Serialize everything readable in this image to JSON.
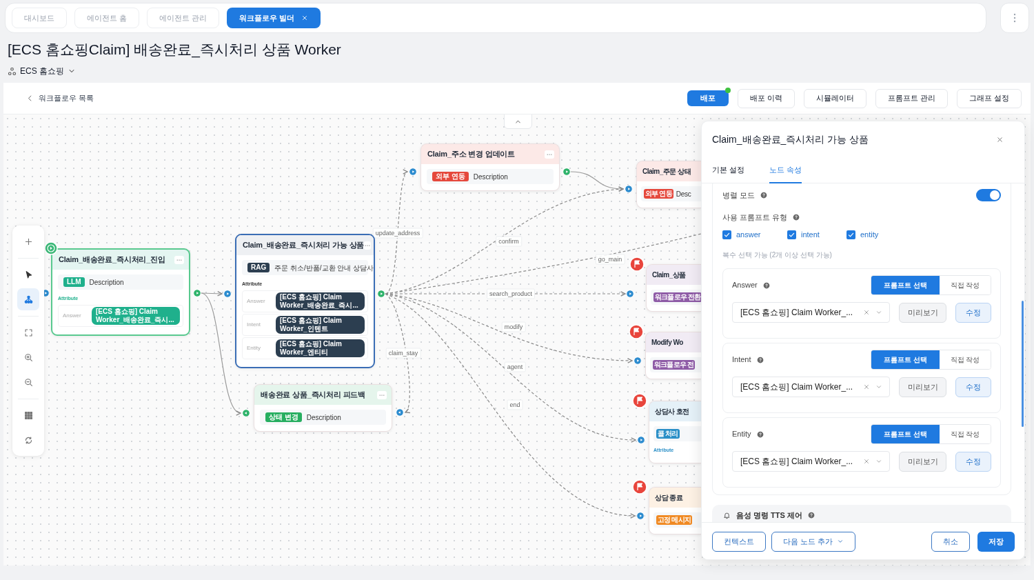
{
  "tabs": [
    {
      "label": "대시보드",
      "selected": false
    },
    {
      "label": "에이전트 홈",
      "selected": false
    },
    {
      "label": "에이전트 관리",
      "selected": false
    },
    {
      "label": "워크플로우 빌더",
      "selected": true
    }
  ],
  "title": "[ECS 홈쇼핑Claim] 배송완료_즉시처리 상품 Worker",
  "workspace": "ECS 홈쇼핑",
  "back_link": "워크플로우 목록",
  "actions": [
    {
      "label": "배포",
      "kind": "primary",
      "notified": true
    },
    {
      "label": "배포 이력",
      "kind": "default",
      "notified": false
    },
    {
      "label": "시뮬레이터",
      "kind": "default",
      "notified": false
    },
    {
      "label": "프롬프트 관리",
      "kind": "default",
      "notified": false
    },
    {
      "label": "그래프 설정",
      "kind": "default",
      "notified": false
    }
  ],
  "tools": [
    {
      "kind": "add",
      "selected": false
    },
    {
      "kind": "select",
      "selected": false
    },
    {
      "kind": "layout",
      "selected": true
    },
    {
      "kind": "fit",
      "selected": false
    },
    {
      "kind": "zoom_in",
      "selected": false
    },
    {
      "kind": "zoom_out",
      "selected": false
    },
    {
      "kind": "grid",
      "selected": false
    },
    {
      "kind": "reset",
      "selected": false
    }
  ],
  "nodes": [
    {
      "title": "Claim_배송완료_즉시처리_진입",
      "kind": "start",
      "selected": false,
      "badge": {
        "label": "LLM",
        "color": "#1fb08c"
      },
      "description": "Description",
      "attribute_heading": "Attribute",
      "attributes": [
        {
          "name": "Answer",
          "value": "[ECS 홈쇼핑] Claim Worker_배송완료_즉시..."
        }
      ]
    },
    {
      "title": "Claim_배송완료_즉시처리 가능 상품",
      "kind": "task",
      "selected": true,
      "badge": {
        "label": "RAG",
        "color": "#2c3e50"
      },
      "description": "주문 취소/반품/교환 안내 상담사",
      "attribute_heading": "Attribute",
      "attributes": [
        {
          "name": "Answer",
          "value": "[ECS 홈쇼핑] Claim Worker_배송완료_즉시..."
        },
        {
          "name": "Intent",
          "value": "[ECS 홈쇼핑] Claim Worker_인텐트"
        },
        {
          "name": "Entity",
          "value": "[ECS 홈쇼핑] Claim Worker_엔티티"
        }
      ]
    },
    {
      "title": "배송완료 상품_즉시처리 피드백",
      "kind": "task",
      "selected": false,
      "badge": {
        "label": "상태 변경",
        "color": "#27ae60"
      },
      "description": "Description"
    },
    {
      "title": "Claim_주소 변경 업데이트",
      "kind": "task",
      "selected": false,
      "badge": {
        "label": "외부 연동",
        "color": "#e5483c"
      },
      "description": "Description"
    },
    {
      "title": "Claim_주문 상태",
      "kind": "task",
      "selected": false,
      "badge": {
        "label": "외부 연동",
        "color": "#e5483c"
      },
      "description": "Desc"
    },
    {
      "title": "Claim_상품",
      "kind": "end",
      "selected": false,
      "badge": {
        "label": "워크플로우 전환",
        "color": "#8e5ba6"
      }
    },
    {
      "title": "Modify Wo",
      "kind": "end",
      "selected": false,
      "badge": {
        "label": "워크플로우 전",
        "color": "#8e5ba6"
      }
    },
    {
      "title": "상담사 호전",
      "kind": "end",
      "selected": false,
      "badge": {
        "label": "콜 처리",
        "color": "#2a8fc7"
      },
      "attribute_heading": "Attribute"
    },
    {
      "title": "상담 종료",
      "kind": "end",
      "selected": false,
      "badge": {
        "label": "고정 메시지",
        "color": "#f08a24"
      }
    }
  ],
  "edges": [
    {
      "label": "update_address"
    },
    {
      "label": "confirm"
    },
    {
      "label": "go_main"
    },
    {
      "label": "search_product"
    },
    {
      "label": "modify"
    },
    {
      "label": "agent"
    },
    {
      "label": "end"
    },
    {
      "label": "claim_stay"
    }
  ],
  "panel": {
    "title": "Claim_배송완료_즉시처리 가능 상품",
    "tabs": [
      {
        "label": "기본 설정",
        "selected": false
      },
      {
        "label": "노드 속성",
        "selected": true
      }
    ],
    "parallel_mode": {
      "label": "병렬 모드",
      "on": true
    },
    "prompt_types": {
      "label": "사용 프롬프트 유형",
      "options": [
        {
          "label": "answer",
          "checked": true
        },
        {
          "label": "intent",
          "checked": true
        },
        {
          "label": "entity",
          "checked": true
        }
      ],
      "hint": "복수 선택 가능 (2개 이상 선택 가능)"
    },
    "prompts": [
      {
        "label": "Answer",
        "modes": [
          {
            "label": "프롬프트 선택",
            "selected": true
          },
          {
            "label": "직접 작성",
            "selected": false
          }
        ],
        "value": "[ECS 홈쇼핑] Claim Worker_...",
        "actions": [
          "미리보기",
          "수정"
        ]
      },
      {
        "label": "Intent",
        "modes": [
          {
            "label": "프롬프트 선택",
            "selected": true
          },
          {
            "label": "직접 작성",
            "selected": false
          }
        ],
        "value": "[ECS 홈쇼핑] Claim Worker_...",
        "actions": [
          "미리보기",
          "수정"
        ]
      },
      {
        "label": "Entity",
        "modes": [
          {
            "label": "프롬프트 선택",
            "selected": true
          },
          {
            "label": "직접 작성",
            "selected": false
          }
        ],
        "value": "[ECS 홈쇼핑] Claim Worker_...",
        "actions": [
          "미리보기",
          "수정"
        ]
      }
    ],
    "section": "음성 명령 TTS 제어",
    "footer_left": [
      {
        "label": "컨텍스트",
        "kind": "outline",
        "menu": false
      },
      {
        "label": "다음 노드 추가",
        "kind": "outline",
        "menu": true
      }
    ],
    "footer_right": [
      {
        "label": "취소",
        "kind": "outline",
        "menu": false
      },
      {
        "label": "저장",
        "kind": "primary",
        "menu": false
      }
    ]
  }
}
